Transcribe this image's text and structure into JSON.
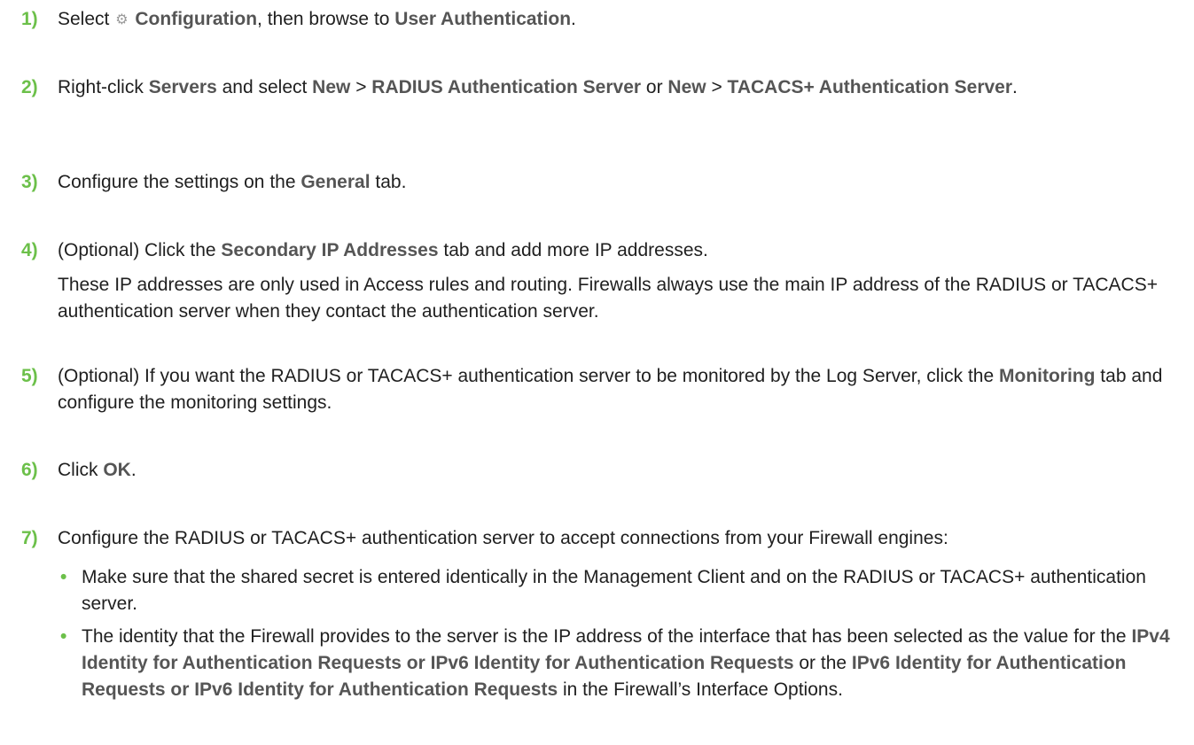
{
  "steps": [
    {
      "num": "1)",
      "parts": [
        {
          "t": "Select "
        },
        {
          "icon": "gear-icon",
          "glyph": "⚙"
        },
        {
          "t": " "
        },
        {
          "t": "Configuration",
          "b": true
        },
        {
          "t": ", then browse to "
        },
        {
          "t": "User Authentication",
          "b": true
        },
        {
          "t": "."
        }
      ]
    },
    {
      "num": "2)",
      "parts": [
        {
          "t": "Right-click "
        },
        {
          "t": "Servers",
          "b": true
        },
        {
          "t": " and select "
        },
        {
          "t": "New",
          "b": true
        },
        {
          "t": " > "
        },
        {
          "t": "RADIUS Authentication Server",
          "b": true
        },
        {
          "t": " or "
        },
        {
          "t": "New",
          "b": true
        },
        {
          "t": " > "
        },
        {
          "t": "TACACS+ Authentication Server",
          "b": true
        },
        {
          "t": "."
        }
      ]
    },
    {
      "num": "3)",
      "parts": [
        {
          "t": "Configure the settings on the "
        },
        {
          "t": "General",
          "b": true
        },
        {
          "t": " tab."
        }
      ]
    },
    {
      "num": "4)",
      "parts": [
        {
          "t": "(Optional) Click the "
        },
        {
          "t": "Secondary IP Addresses",
          "b": true
        },
        {
          "t": " tab and add more IP addresses."
        }
      ],
      "para": "These IP addresses are only used in Access rules and routing. Firewalls always use the main IP address of the RADIUS or TACACS+ authentication server when they contact the authentication server."
    },
    {
      "num": "5)",
      "parts": [
        {
          "t": "(Optional) If you want the RADIUS or TACACS+ authentication server to be monitored by the Log Server, click the "
        },
        {
          "t": "Monitoring",
          "b": true
        },
        {
          "t": " tab and configure the monitoring settings."
        }
      ]
    },
    {
      "num": "6)",
      "parts": [
        {
          "t": "Click "
        },
        {
          "t": "OK",
          "b": true
        },
        {
          "t": "."
        }
      ]
    },
    {
      "num": "7)",
      "parts": [
        {
          "t": "Configure the RADIUS or TACACS+ authentication server to accept connections from your Firewall engines:"
        }
      ],
      "bullet_mark": "•",
      "bullets": [
        [
          {
            "t": "Make sure that the shared secret is entered identically in the Management Client and on the RADIUS or TACACS+ authentication server."
          }
        ],
        [
          {
            "t": "The identity that the Firewall provides to the server is the IP address of the interface that has been selected as the value for the "
          },
          {
            "t": "IPv4 Identity for Authentication Requests or IPv6 Identity for Authentication Requests",
            "b": true
          },
          {
            "t": " or the "
          },
          {
            "t": "IPv6 Identity for Authentication Requests or IPv6 Identity for Authentication Requests",
            "b": true
          },
          {
            "t": " in the Firewall’s Interface Options."
          }
        ]
      ]
    }
  ],
  "colors": {
    "step_number": "#6cc04a",
    "bold_text": "#555555",
    "body_text": "#1f1f1f"
  }
}
